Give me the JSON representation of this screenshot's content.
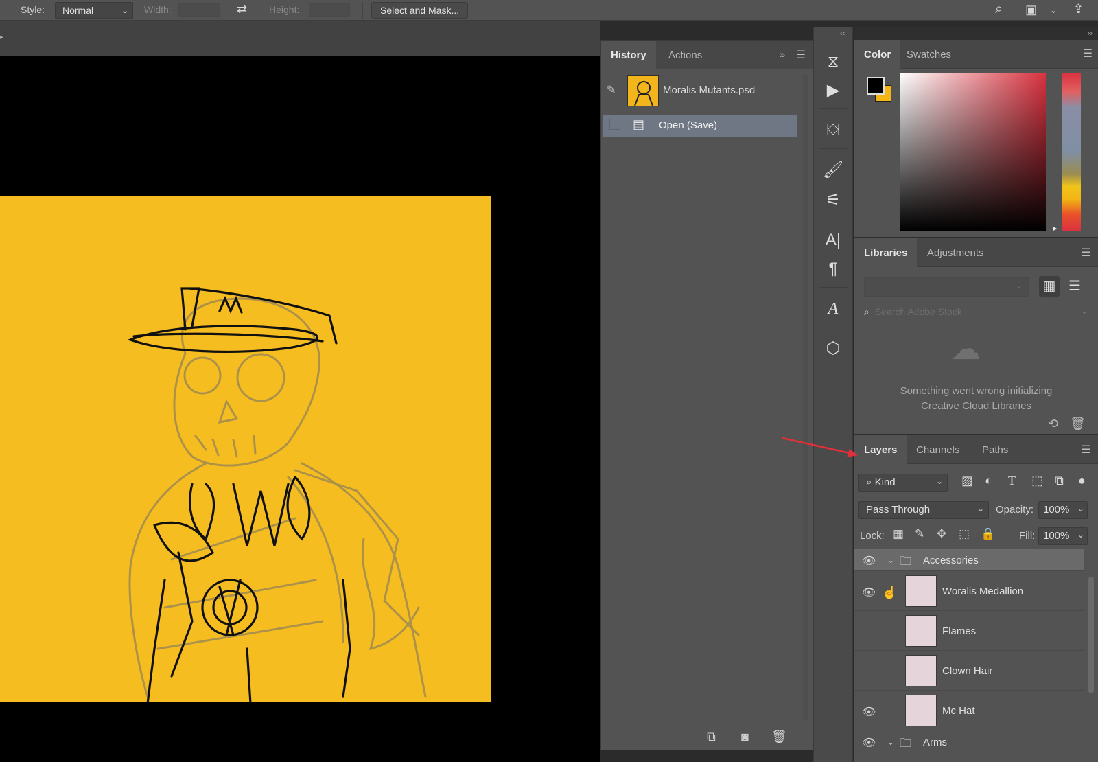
{
  "options_bar": {
    "style_label": "Style:",
    "style_value": "Normal",
    "width_label": "Width:",
    "height_label": "Height:",
    "select_mask_button": "Select and Mask..."
  },
  "history_panel": {
    "tabs": [
      "History",
      "Actions"
    ],
    "snapshot_name": "Moralis Mutants.psd",
    "steps": [
      "Open (Save)"
    ]
  },
  "color_panel": {
    "tabs": [
      "Color",
      "Swatches"
    ],
    "foreground_color": "#000000",
    "background_color": "#f4b614"
  },
  "libraries_panel": {
    "tabs": [
      "Libraries",
      "Adjustments"
    ],
    "search_placeholder": "Search Adobe Stock",
    "error_line1": "Something went wrong initializing",
    "error_line2": "Creative Cloud Libraries"
  },
  "layers_panel": {
    "tabs": [
      "Layers",
      "Channels",
      "Paths"
    ],
    "filter_kind": "Kind",
    "blend_mode": "Pass Through",
    "opacity_label": "Opacity:",
    "opacity_value": "100%",
    "lock_label": "Lock:",
    "fill_label": "Fill:",
    "fill_value": "100%",
    "layers": [
      {
        "name": "Accessories",
        "type": "group",
        "visible": true,
        "selected": true
      },
      {
        "name": "Woralis Medallion",
        "type": "layer",
        "visible": true
      },
      {
        "name": "Flames",
        "type": "layer",
        "visible": false
      },
      {
        "name": "Clown Hair",
        "type": "layer",
        "visible": false
      },
      {
        "name": "Mc Hat",
        "type": "layer",
        "visible": true
      },
      {
        "name": "Arms",
        "type": "group",
        "visible": true
      }
    ]
  },
  "colors": {
    "artboard": "#f6bd21",
    "annotation_arrow": "#e0303a",
    "history_selected": "#6f7784"
  }
}
